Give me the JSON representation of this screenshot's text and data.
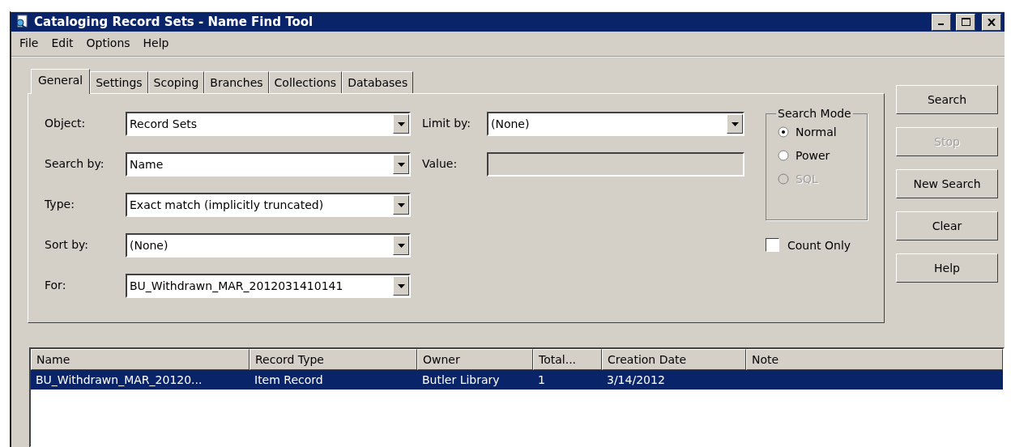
{
  "window": {
    "title": "Cataloging Record Sets - Name Find Tool"
  },
  "menu": [
    "File",
    "Edit",
    "Options",
    "Help"
  ],
  "tabs": [
    {
      "label": "General",
      "selected": true
    },
    {
      "label": "Settings",
      "selected": false
    },
    {
      "label": "Scoping",
      "selected": false
    },
    {
      "label": "Branches",
      "selected": false
    },
    {
      "label": "Collections",
      "selected": false
    },
    {
      "label": "Databases",
      "selected": false
    }
  ],
  "left_fields": [
    {
      "label": "Object:",
      "kind": "combo",
      "value": "Record Sets"
    },
    {
      "label": "Search by:",
      "kind": "combo",
      "value": "Name"
    },
    {
      "label": "Type:",
      "kind": "combo",
      "value": "Exact match (implicitly truncated)"
    },
    {
      "label": "Sort by:",
      "kind": "combo",
      "value": "(None)"
    },
    {
      "label": "For:",
      "kind": "combo",
      "value": "BU_Withdrawn_MAR_2012031410141"
    }
  ],
  "right_fields": [
    {
      "label": "Limit by:",
      "kind": "combo",
      "value": "(None)",
      "disabled": false
    },
    {
      "label": "Value:",
      "kind": "text",
      "disabled": true
    }
  ],
  "search_mode": {
    "title": "Search Mode",
    "options": [
      {
        "label": "Normal",
        "selected": true,
        "disabled": false
      },
      {
        "label": "Power",
        "selected": false,
        "disabled": false
      },
      {
        "label": "SQL",
        "selected": false,
        "disabled": true
      }
    ]
  },
  "count_only": {
    "label": "Count Only",
    "checked": false
  },
  "buttons": [
    {
      "label": "Search",
      "disabled": false
    },
    {
      "label": "Stop",
      "disabled": true
    },
    {
      "label": "New Search",
      "disabled": false
    },
    {
      "label": "Clear",
      "disabled": false
    },
    {
      "label": "Help",
      "disabled": false
    }
  ],
  "table": {
    "columns": [
      "Name",
      "Record Type",
      "Owner",
      "Total...",
      "Creation Date",
      "Note"
    ],
    "rows": [
      {
        "selected": true,
        "cells": [
          "BU_Withdrawn_MAR_20120...",
          "Item Record",
          "Butler Library",
          "1",
          "3/14/2012",
          ""
        ]
      }
    ]
  }
}
